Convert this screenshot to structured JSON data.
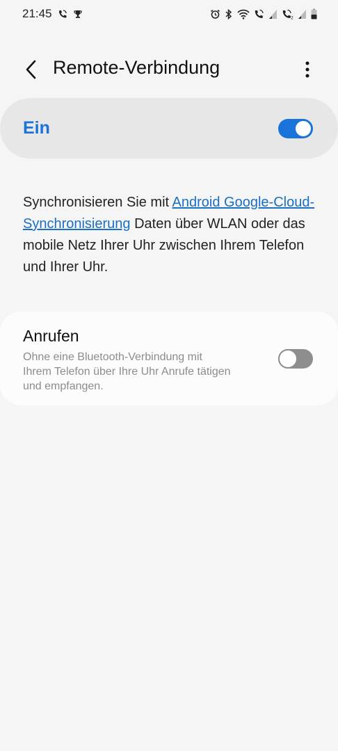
{
  "status_bar": {
    "time": "21:45",
    "left_icons": [
      "wifi-call-icon",
      "trophy-icon"
    ],
    "right_icons": [
      "alarm-icon",
      "bluetooth-icon",
      "wifi-icon",
      "volte-call-icon",
      "signal-icon",
      "volte-call-2-icon",
      "signal-2-icon",
      "battery-icon"
    ]
  },
  "header": {
    "title": "Remote-Verbindung"
  },
  "master_switch": {
    "label": "Ein",
    "state": "on"
  },
  "description": {
    "prefix": "Synchronisieren Sie mit ",
    "link_text": "Android Google-Cloud-Synchronisierung",
    "suffix": " Daten über WLAN oder das mobile Netz Ihrer Uhr zwischen Ihrem Telefon und Ihrer Uhr."
  },
  "calls": {
    "title": "Anrufen",
    "subtitle": "Ohne eine Bluetooth-Verbindung mit Ihrem Telefon über Ihre Uhr Anrufe tätigen und empfangen.",
    "state": "off"
  },
  "colors": {
    "accent": "#1a73d8",
    "link": "#1a6fc4",
    "background": "#f5f5f5",
    "switch_bar": "#e7e7e7",
    "card": "#fcfcfc"
  }
}
